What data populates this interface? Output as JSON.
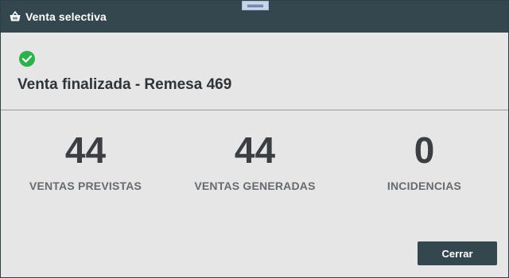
{
  "window": {
    "title": "Venta selectiva",
    "title_icon": "basket-icon",
    "drag_handle_icon": "drag-handle-icon"
  },
  "header": {
    "status_icon": "check-circle-icon",
    "status_color": "#2bb34a",
    "headline": "Venta finalizada - Remesa 469"
  },
  "stats": [
    {
      "value": "44",
      "label": "VENTAS PREVISTAS"
    },
    {
      "value": "44",
      "label": "VENTAS GENERADAS"
    },
    {
      "value": "0",
      "label": "INCIDENCIAS"
    }
  ],
  "footer": {
    "close_label": "Cerrar"
  },
  "colors": {
    "titlebar": "#34474f",
    "body": "#e6e6e6",
    "button": "#34474f"
  }
}
